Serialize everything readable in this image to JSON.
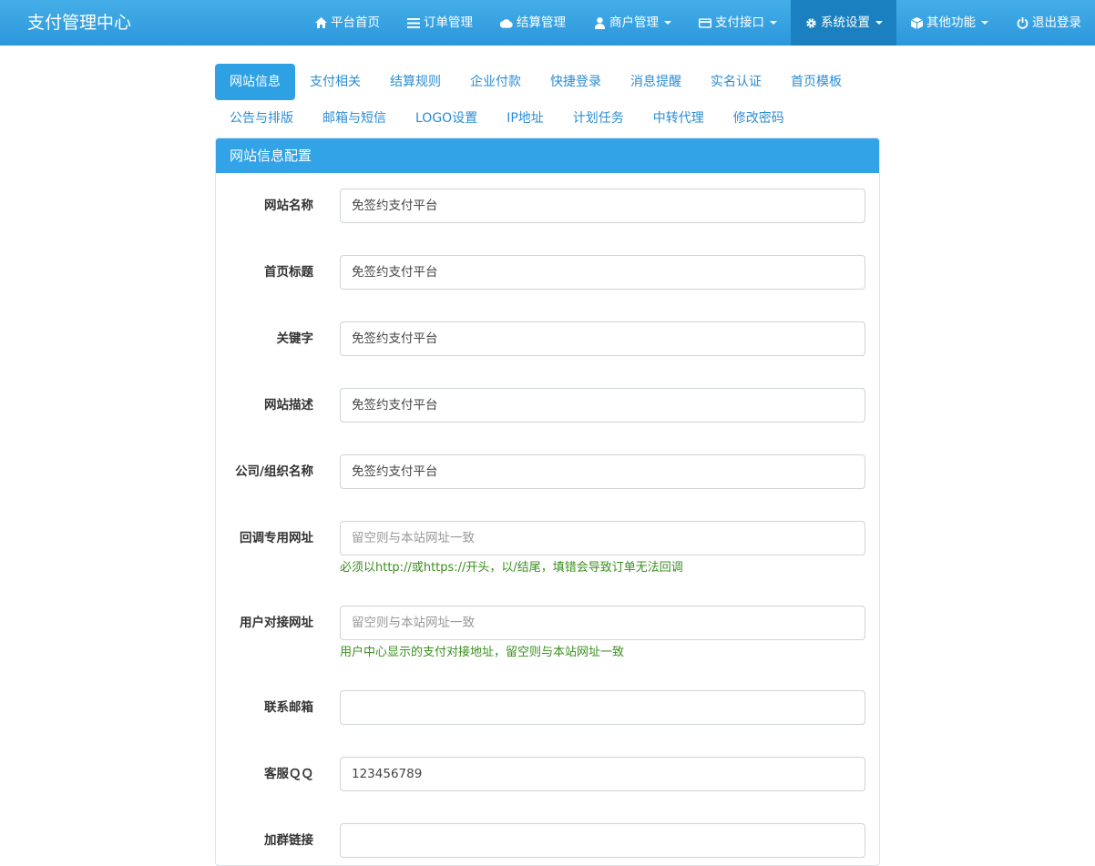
{
  "brand": "支付管理中心",
  "nav": [
    {
      "label": "平台首页",
      "icon": "home-icon",
      "caret": false,
      "active": false
    },
    {
      "label": "订单管理",
      "icon": "list-icon",
      "caret": false,
      "active": false
    },
    {
      "label": "结算管理",
      "icon": "cloud-icon",
      "caret": false,
      "active": false
    },
    {
      "label": "商户管理",
      "icon": "user-icon",
      "caret": true,
      "active": false
    },
    {
      "label": "支付接口",
      "icon": "credit-card-icon",
      "caret": true,
      "active": false
    },
    {
      "label": "系统设置",
      "icon": "gear-icon",
      "caret": true,
      "active": true
    },
    {
      "label": "其他功能",
      "icon": "cube-icon",
      "caret": true,
      "active": false
    },
    {
      "label": "退出登录",
      "icon": "power-icon",
      "caret": false,
      "active": false
    }
  ],
  "tabs": [
    {
      "label": "网站信息",
      "active": true
    },
    {
      "label": "支付相关",
      "active": false
    },
    {
      "label": "结算规则",
      "active": false
    },
    {
      "label": "企业付款",
      "active": false
    },
    {
      "label": "快捷登录",
      "active": false
    },
    {
      "label": "消息提醒",
      "active": false
    },
    {
      "label": "实名认证",
      "active": false
    },
    {
      "label": "首页模板",
      "active": false
    },
    {
      "label": "公告与排版",
      "active": false
    },
    {
      "label": "邮箱与短信",
      "active": false
    },
    {
      "label": "LOGO设置",
      "active": false
    },
    {
      "label": "IP地址",
      "active": false
    },
    {
      "label": "计划任务",
      "active": false
    },
    {
      "label": "中转代理",
      "active": false
    },
    {
      "label": "修改密码",
      "active": false
    }
  ],
  "panel": {
    "title": "网站信息配置",
    "fields": [
      {
        "label": "网站名称",
        "value": "免签约支付平台",
        "placeholder": "",
        "help": ""
      },
      {
        "label": "首页标题",
        "value": "免签约支付平台",
        "placeholder": "",
        "help": ""
      },
      {
        "label": "关键字",
        "value": "免签约支付平台",
        "placeholder": "",
        "help": ""
      },
      {
        "label": "网站描述",
        "value": "免签约支付平台",
        "placeholder": "",
        "help": ""
      },
      {
        "label": "公司/组织名称",
        "value": "免签约支付平台",
        "placeholder": "",
        "help": ""
      },
      {
        "label": "回调专用网址",
        "value": "",
        "placeholder": "留空则与本站网址一致",
        "help": "必须以http://或https://开头，以/结尾，填错会导致订单无法回调"
      },
      {
        "label": "用户对接网址",
        "value": "",
        "placeholder": "留空则与本站网址一致",
        "help": "用户中心显示的支付对接地址，留空则与本站网址一致"
      },
      {
        "label": "联系邮箱",
        "value": "",
        "placeholder": "",
        "help": ""
      },
      {
        "label": "客服ＱＱ",
        "value": "123456789",
        "placeholder": "",
        "help": ""
      },
      {
        "label": "加群链接",
        "value": "",
        "placeholder": "",
        "help": ""
      }
    ]
  },
  "colors": {
    "navbar": "#2b97db",
    "active_nav": "#1a80bf",
    "tab_active": "#2ea1e5",
    "panel_heading": "#32a3e6",
    "help_text": "#3a8f1e"
  }
}
